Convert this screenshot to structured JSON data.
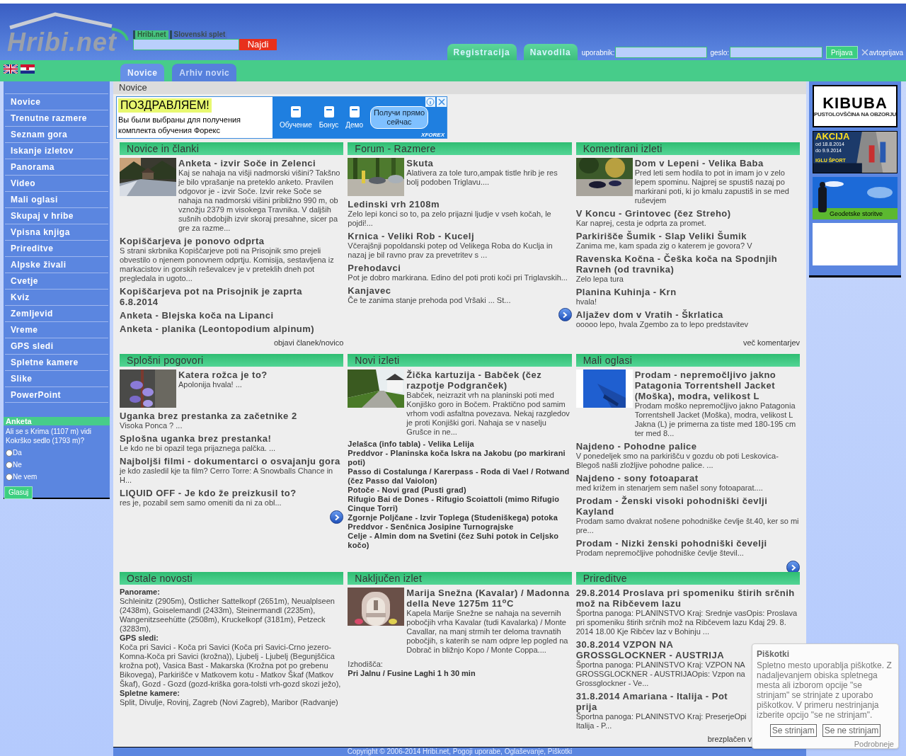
{
  "header": {
    "logo": "Hribi.net",
    "search": {
      "scopes": [
        {
          "label": "Hribi.net",
          "selected": true
        },
        {
          "label": "Slovenski splet",
          "selected": false
        }
      ],
      "button": "Najdi"
    },
    "account_tabs": [
      "Registracija",
      "Navodila"
    ],
    "login": {
      "username_label": "uporabnik:",
      "password_label": "geslo:",
      "button": "Prijava",
      "autologin": "avtoprijava"
    }
  },
  "nav_tabs": [
    {
      "label": "Novice",
      "selected": true
    },
    {
      "label": "Arhiv novic",
      "selected": false
    }
  ],
  "sidebar": {
    "items": [
      "Novice",
      "Trenutne razmere",
      "Seznam gora",
      "Iskanje izletov",
      "Panorama",
      "Video",
      "Mali oglasi",
      "Skupaj v hribe",
      "Vpisna knjiga",
      "Prireditve",
      "Alpske živali",
      "Cvetje",
      "Kviz",
      "Zemljevid",
      "Vreme",
      "GPS sledi",
      "Spletne kamere",
      "Slike",
      "PowerPoint"
    ],
    "poll": {
      "title": "Anketa",
      "question": "Ali se s Krima (1107 m) vidi Kokrško sedlo (1793 m)?",
      "options": [
        {
          "label": "Da",
          "selected": false
        },
        {
          "label": "Ne",
          "selected": false
        },
        {
          "label": "Ne vem",
          "selected": false
        }
      ],
      "button": "Glasuj"
    }
  },
  "breadcrumb": "Novice",
  "banner": {
    "headline": "ПОЗДРАВЛЯЕМ!",
    "text": "Вы были выбраны для получения комплекта обучения Форекс",
    "steps": [
      "Обучение",
      "Бонус",
      "Демо"
    ],
    "button": "Получи прямо сейчас",
    "brand": "XFOREX"
  },
  "sections": [
    {
      "title": "Novice in članki",
      "next_button": false,
      "link": "objavi članek/novico",
      "entries": [
        {
          "kind": "article",
          "title": "Anketa - izvir Soče in Zelenci",
          "description": "Kaj se nahaja na višji nadmorski višini? Takšno je bilo vprašanje na preteklo anketo. Pravilen odgovor je - izvir Soče. Izvir reke Soče se nahaja na nadmorski višini približno 990 m, ob vznožju 2379 m visokega Travnika. V daljših sušnih obdobjih izvir skoraj presahne, sicer pa gre za razme..."
        },
        {
          "kind": "article",
          "title": "Kopiščarjeva je ponovo odprta",
          "description": "S strani skrbnika Kopiščarjeve poti na Prisojnik smo prejeli obvestilo o njenem ponovnem odprtju. Komisija, sestavljena iz markacistov in gorskih reševalcev je v preteklih dneh pot pregledala in ugoto..."
        },
        {
          "kind": "article",
          "title": "Kopiščarjeva pot na Prisojnik je zaprta 6.8.2014"
        },
        {
          "kind": "article",
          "title": "Anketa - Blejska koča na Lipanci"
        },
        {
          "kind": "article",
          "title": "Anketa - planika (Leontopodium alpinum)"
        }
      ]
    },
    {
      "title": "Forum - Razmere",
      "next_button": true,
      "entries": [
        {
          "kind": "article",
          "title": "Skuta",
          "description": "Alativera za tole turo,ampak tistle hrib je res bolj podoben Triglavu...."
        },
        {
          "kind": "article",
          "title": "Ledinski vrh 2108m",
          "description": "Zelo lepi konci so to, pa zelo prijazni ljudje v vseh kočah, le pojdi!..."
        },
        {
          "kind": "article",
          "title": "Krnica - Veliki Rob - Kucelj",
          "description": "Včerajšnji popoldanski potep od Velikega Roba do Kuclja in nazaj je bil ravno prav za prevetritev s ..."
        },
        {
          "kind": "article",
          "title": "Prehodavci",
          "description": "Pot je dobro markirana. Edino del poti proti koči pri Triglavskih..."
        },
        {
          "kind": "article",
          "title": "Kanjavec",
          "description": "Če te zanima stanje prehoda pod Vršaki ... St..."
        }
      ]
    },
    {
      "title": "Komentirani izleti",
      "next_button": false,
      "link": "več komentarjev",
      "entries": [
        {
          "kind": "article",
          "title": "Dom v Lepeni - Velika Baba",
          "description": "Pred leti sem hodila to pot in imam jo v zelo lepem spominu. Najprej se spustiš nazaj po markirani poti, ki jo kmalu zapustiš in se med ruševjem"
        },
        {
          "kind": "article",
          "title": "V Koncu - Grintovec (čez Streho)",
          "description": "Kar naprej, cesta je odprta za promet."
        },
        {
          "kind": "article",
          "title": "Parkirišče Šumik - Slap Veliki Šumik",
          "description": "Zanima me, kam spada zig o katerem je govora? V"
        },
        {
          "kind": "article",
          "title": "Ravenska Kočna - Češka koča na Spodnjih Ravneh (od travnika)",
          "description": "Zelo lepa tura"
        },
        {
          "kind": "article",
          "title": "Planina Kuhinja - Krn",
          "description": "hvala!"
        },
        {
          "kind": "article",
          "title": "Aljažev dom v Vratih - Škrlatica",
          "description": "ooooo lepo, hvala Zgembo za to lepo predstavitev"
        }
      ]
    },
    {
      "title": "Splošni pogovori",
      "next_button": true,
      "entries": [
        {
          "kind": "article",
          "title": "Katera rožca je to?",
          "description": "Apolonija hvala! ..."
        },
        {
          "kind": "article",
          "title": "Uganka brez prestanka za začetnike 2",
          "description": "Visoka Ponca ? ..."
        },
        {
          "kind": "article",
          "title": "Splošna uganka brez prestanka!",
          "description": "Le kdo ne bi opazil tega prijaznega palčka. ..."
        },
        {
          "kind": "article",
          "title": "Najboljši filmi - dokumentarci o osvajanju gora",
          "description": "je kdo zasledil kje ta film? Cerro Torre: A Snowballs Chance in H..."
        },
        {
          "kind": "article",
          "title": "LIQUID OFF - Je kdo že preizkusil to?",
          "description": "res je, pozabil sem samo omeniti da ni za obl..."
        }
      ]
    },
    {
      "title": "Novi izleti",
      "next_button": false,
      "entries": [
        {
          "kind": "article",
          "title": "Žička kartuzija - Babček (čez razpotje Podgranček)",
          "description": "Babček, neizrazit vrh na planinski poti med Konjiško goro in Bočem. Praktično pod samim vrhom vodi asfaltna povezava. Nekaj razgledov je proti Konjiški gori. Nahaja se v naselju Grušce in ne..."
        },
        {
          "kind": "compact",
          "title": "Jelašca (info tabla) - Velika Lelija"
        },
        {
          "kind": "compact",
          "title": "Preddvor - Planinska koča Iskra na Jakobu (po markirani poti)"
        },
        {
          "kind": "compact",
          "title": "Passo di Costalunga / Karerpass - Roda di Vael / Rotwand (čez Passo dal Vaiolon)"
        },
        {
          "kind": "compact",
          "title": "Potoče - Novi grad (Pusti grad)"
        },
        {
          "kind": "compact",
          "title": "Rifugio Bai de Dones - Rifugio Scoiattoli (mimo Rifugio Cinque Torri)"
        },
        {
          "kind": "compact",
          "title": "Zgornje Poljčane - Izvir Toplega (Studeniškega) potoka"
        },
        {
          "kind": "compact",
          "title": "Preddvor - Senčnica Josipine Turnograjske"
        },
        {
          "kind": "compact",
          "title": "Celje - Almin dom na Svetini (čez Suhi potok in Celjsko kočo)"
        }
      ]
    },
    {
      "title": "Mali oglasi",
      "next_button": true,
      "entries": [
        {
          "kind": "article",
          "title": "Prodam - nepremočljivo jakno Patagonia Torrentshell Jacket (Moška), modra, velikost L",
          "description": "Prodam moško nepremočljivo jakno Patagonia Torrentshell Jacket (Moška), modra, velikost L Jakna (L) je primerna za tiste med 180-195 cm ter med 8..."
        },
        {
          "kind": "article",
          "title": "Najdeno - Pohodne palice",
          "description": "V ponedeljek smo na parkirišču v gozdu ob poti Leskovica-Blegoš našli zložljive pohodne palice. ..."
        },
        {
          "kind": "article",
          "title": "Najdeno - sony fotoaparat",
          "description": "med križem in stenarjem sem našel sony fotoaparat...."
        },
        {
          "kind": "article",
          "title": "Prodam - Ženski visoki pohodniški čevlji Kayland",
          "description": "Prodam samo dvakrat nošene pohodniške čevlje št.40, ker so mi pre..."
        },
        {
          "kind": "article",
          "title": "Prodam - Nizki ženski pohodniški čevelji",
          "description": "Prodam nepremočljive pohodniške čevlje števil..."
        }
      ]
    },
    {
      "title": "Ostale novosti",
      "next_button": false,
      "entries": [
        {
          "kind": "group",
          "label": "Panorame:",
          "text": "Schleinitz (2905m), Östlicher Sattelkopf (2651m), Neualplseen (2438m), Goiselemandl (2433m), Steinermandl (2235m), Wangenitzseehütte (2508m), Kruckelkopf (3181m), Petzeck (3283m),"
        },
        {
          "kind": "group",
          "label": "GPS sledi:",
          "text": "Koča pri Savici - Koča pri Savici (Koča pri Savici-Crno jezero-Komna-Koča pri Savici (krožna)), Ljubelj - Ljubelj (Begunjščica krožna pot), Vasica Bast - Makarska (Krožna pot po grebenu Bikovega), Parkirišče v Matkovem kotu - Matkov Škaf (Matkov Škaf), Gozd - Gozd (gozd-kriška gora-tolsti vrh-gozd skozi ježo),"
        },
        {
          "kind": "group",
          "label": "Spletne kamere:",
          "text": "Split, Divulje, Rovinj, Zagreb (Novi Zagreb), Maribor (Radvanje)"
        }
      ]
    },
    {
      "title": "Naključen izlet",
      "next_button": false,
      "entries": [
        {
          "kind": "article",
          "title": "Marija Snežna (Kavalar) / Madonna della Neve 1275m 11$^{o}$C",
          "description": "Kapela Marije Snežne se nahaja na severnih pobočjih vrha Kavalar (tudi Kavalarka) / Monte Cavallar, na manj strmih ter deloma travnatih pobočjih, s katerih se nam odpre lep pogled na Dobrač in bližnjo Kopo / Monte Coppa...."
        },
        {
          "kind": "field",
          "label": "Izhodišča:",
          "value": "Pri Jalnu / Fusine Laghi 1 h 30 min"
        }
      ]
    },
    {
      "title": "Prireditve",
      "next_button": false,
      "link": "brezplačen v",
      "entries": [
        {
          "kind": "article",
          "title": "29.8.2014 Proslava pri spomeniku štirih srčnih mož na Ribčevem lazu",
          "description": "Športna panoga: PLANINSTVO Kraj: Srednje vasOpis: Proslava pri spomeniku štirih srčnih mož na Ribčevem lazu Kdaj 29. 8. 2014 18.00 Kje Ribčev laz v Bohinju ..."
        },
        {
          "kind": "article",
          "title": "30.8.2014 VZPON NA GROSSGLOCKNER - AUSTRIJA",
          "description": "Športna panoga: PLANINSTVO Kraj: VZPON NA GROSSGLOCKNER - AUSTRIJAOpis: Vzpon na Grossglockner - Ve..."
        },
        {
          "kind": "article",
          "title": "31.8.2014 Amariana - Italija - Pot prija",
          "description": [
            "Športna panoga: PLANINSTVO Kraj: PreserjeOpi",
            "Italija - P..."
          ]
        }
      ]
    }
  ],
  "ads": [
    {
      "kind": "kibuba",
      "lines": [
        "KIBUBA",
        "PUSTOLOVŠČINA NA OBZORJU"
      ]
    },
    {
      "kind": "akcija",
      "lines": [
        "AKCIJA",
        "od 18.8.2014",
        "do 9.9.2014",
        "IGLU ŠPORT"
      ]
    },
    {
      "kind": "geodetske",
      "lines": [
        "Geodetske storitve"
      ]
    },
    {
      "kind": "blank"
    }
  ],
  "footer": "Copyright © 2006-2014 Hribi.net, Pogoji uporabe, Oglaševanje, Piškotki",
  "cookie_notice": {
    "title": "Piškotki",
    "text": "Spletno mesto uporablja piškotke. Z nadaljevanjem obiska spletnega mesta ali izborom opcije \"se strinjam\" se strinjate z uporabo piškotkov. V primeru nestrinjanja izberite opcijo \"se ne strinjam\".",
    "buttons": [
      "Se strinjam",
      "Se ne strinjam"
    ],
    "link": "Podrobneje"
  }
}
